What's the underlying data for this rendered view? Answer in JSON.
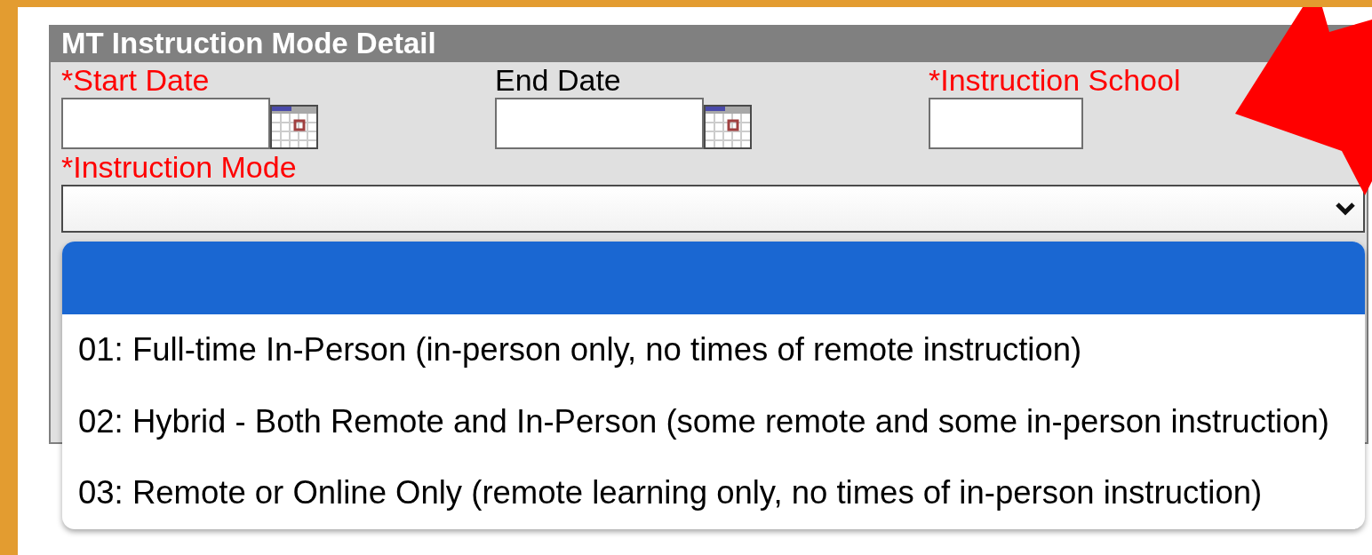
{
  "panel": {
    "title": "MT Instruction Mode Detail"
  },
  "fields": [
    {
      "label": "*Start Date",
      "required": true,
      "kind": "date"
    },
    {
      "label": "End Date",
      "required": false,
      "kind": "date"
    },
    {
      "label": "*Instruction School",
      "required": true,
      "kind": "text"
    }
  ],
  "instruction_mode": {
    "label": "*Instruction Mode",
    "required": true,
    "expanded": true,
    "options": [
      {
        "selected": true
      },
      {
        "text": "01: Full-time In-Person (in-person only, no times of remote instruction)",
        "selected": false
      },
      {
        "text": "02: Hybrid - Both Remote and In-Person (some remote and some in-person instruction)",
        "selected": false
      },
      {
        "text": "03: Remote or Online Only (remote learning only, no times of in-person instruction)",
        "selected": false
      }
    ]
  }
}
